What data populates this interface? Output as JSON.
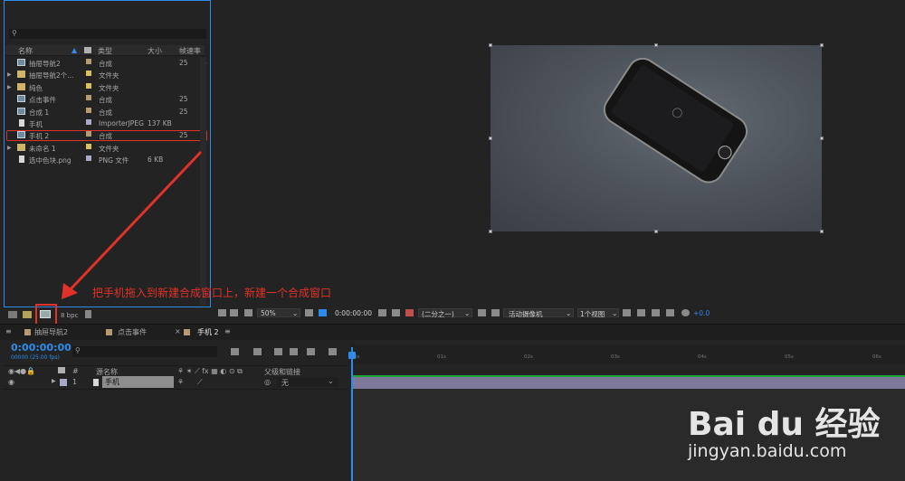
{
  "project": {
    "search_icon": "search-icon",
    "columns": {
      "name": "名称",
      "type": "类型",
      "size": "大小",
      "fps": "帧速率"
    },
    "items": [
      {
        "name": "抽屉导航2",
        "type": "合成",
        "size": "",
        "fps": "25",
        "kind": "comp",
        "color": "#b49c6e"
      },
      {
        "name": "抽屉导航2个...",
        "type": "文件夹",
        "size": "",
        "fps": "",
        "kind": "folder",
        "color": "#d8c25a"
      },
      {
        "name": "纯色",
        "type": "文件夹",
        "size": "",
        "fps": "",
        "kind": "folder",
        "color": "#d8c25a"
      },
      {
        "name": "点击事件",
        "type": "合成",
        "size": "",
        "fps": "25",
        "kind": "comp",
        "color": "#b49c6e"
      },
      {
        "name": "合成 1",
        "type": "合成",
        "size": "",
        "fps": "25",
        "kind": "comp",
        "color": "#b49c6e"
      },
      {
        "name": "手机",
        "type": "ImporterJPEG",
        "size": "137 KB",
        "fps": "",
        "kind": "file",
        "color": "#a8a8c8"
      },
      {
        "name": "手机 2",
        "type": "合成",
        "size": "",
        "fps": "25",
        "kind": "comp",
        "color": "#b49c6e"
      },
      {
        "name": "未命名 1",
        "type": "文件夹",
        "size": "",
        "fps": "",
        "kind": "folder",
        "color": "#d8c25a"
      },
      {
        "name": "选中色块.png",
        "type": "PNG 文件",
        "size": "6 KB",
        "fps": "",
        "kind": "file",
        "color": "#a8a8c8"
      }
    ],
    "bpc": "8 bpc"
  },
  "annotation": {
    "text": "把手机拖入到新建合成窗口上，新建一个合成窗口",
    "color": "#e0312a"
  },
  "viewer": {
    "zoom": "50%",
    "timecode": "0:00:00:00",
    "resolution": "(二分之一)",
    "camera": "活动摄像机",
    "views": "1个视图",
    "exposure": "+0.0"
  },
  "timeline": {
    "tabs": [
      {
        "label": "抽屉导航2",
        "color": "#b49c6e"
      },
      {
        "label": "点击事件",
        "color": "#b49c6e"
      },
      {
        "label": "手机 2",
        "color": "#b49c6e"
      }
    ],
    "timecode": "0:00:00:00",
    "timecode_sub": "00000 (25.00 fps)",
    "headers": {
      "source_name": "源名称",
      "parent": "父级和链接"
    },
    "layer": {
      "index": "1",
      "name": "手机",
      "parent": "无",
      "color": "#a8a8c8"
    },
    "ruler_ticks": [
      "0s",
      "01s",
      "02s",
      "03s",
      "04s",
      "05s",
      "06s"
    ]
  },
  "watermark": {
    "logo": "Bai du 经验",
    "url": "jingyan.baidu.com"
  },
  "accent": "#2d8ceb"
}
